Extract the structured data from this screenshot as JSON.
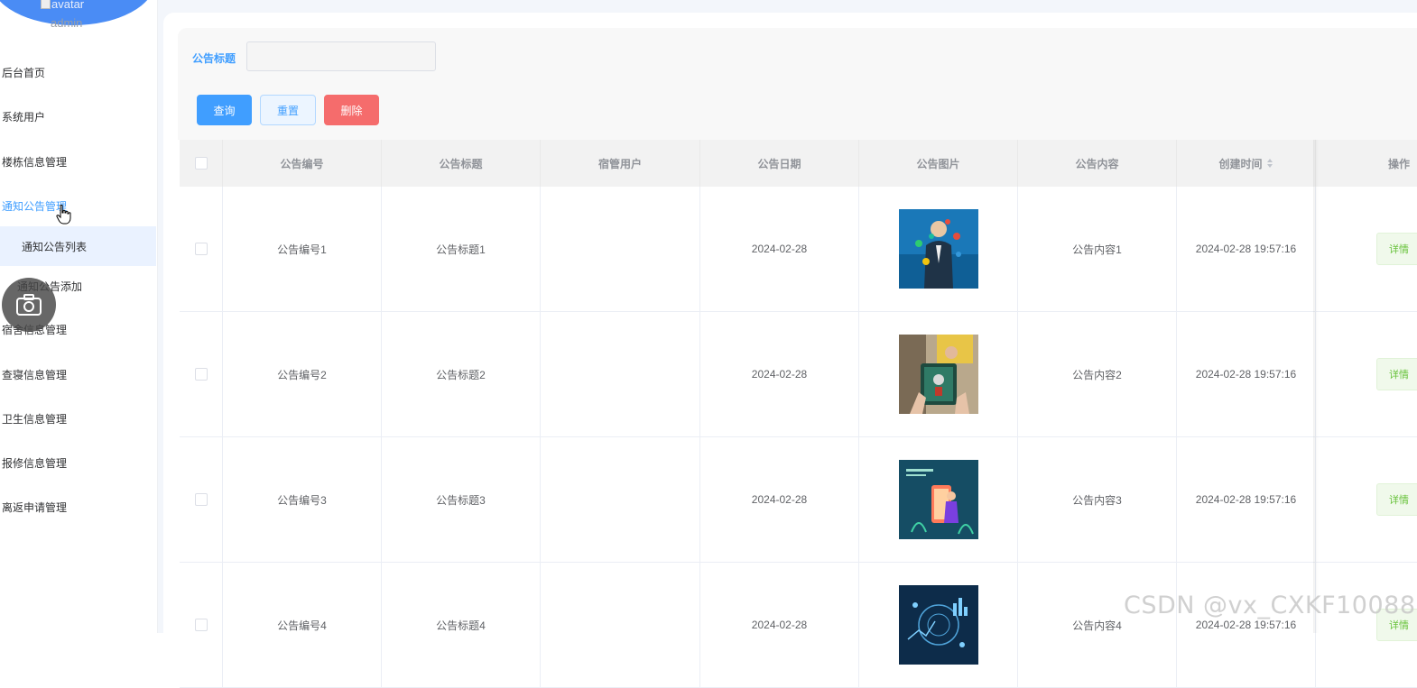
{
  "sidebar": {
    "avatar_alt": "avatar",
    "username": "admin",
    "items": [
      {
        "label": "后台首页"
      },
      {
        "label": "系统用户"
      },
      {
        "label": "楼栋信息管理"
      },
      {
        "label": "通知公告管理"
      },
      {
        "label": "宿舍信息管理"
      },
      {
        "label": "查寝信息管理"
      },
      {
        "label": "卫生信息管理"
      },
      {
        "label": "报修信息管理"
      },
      {
        "label": "离返申请管理"
      }
    ],
    "submenu": [
      {
        "label": "通知公告列表"
      },
      {
        "label": "通知公告添加"
      }
    ]
  },
  "search": {
    "label": "公告标题",
    "value": "",
    "placeholder": ""
  },
  "buttons": {
    "query": "查询",
    "reset": "重置",
    "delete": "删除"
  },
  "table": {
    "columns": [
      "公告编号",
      "公告标题",
      "宿管用户",
      "公告日期",
      "公告图片",
      "公告内容",
      "创建时间",
      "操作"
    ],
    "rows": [
      {
        "no": "公告编号1",
        "title": "公告标题1",
        "user": "",
        "date": "2024-02-28",
        "content": "公告内容1",
        "created": "2024-02-28 19:57:16",
        "action": "详情"
      },
      {
        "no": "公告编号2",
        "title": "公告标题2",
        "user": "",
        "date": "2024-02-28",
        "content": "公告内容2",
        "created": "2024-02-28 19:57:16",
        "action": "详情"
      },
      {
        "no": "公告编号3",
        "title": "公告标题3",
        "user": "",
        "date": "2024-02-28",
        "content": "公告内容3",
        "created": "2024-02-28 19:57:16",
        "action": "详情"
      },
      {
        "no": "公告编号4",
        "title": "公告标题4",
        "user": "",
        "date": "2024-02-28",
        "content": "公告内容4",
        "created": "2024-02-28 19:57:16",
        "action": "详情"
      }
    ]
  },
  "watermark": "CSDN @vx_CXKF10088",
  "colors": {
    "primary": "#409eff",
    "danger": "#f56c6c",
    "success": "#67c23a",
    "avatar_bg": "#4a8cf5"
  }
}
